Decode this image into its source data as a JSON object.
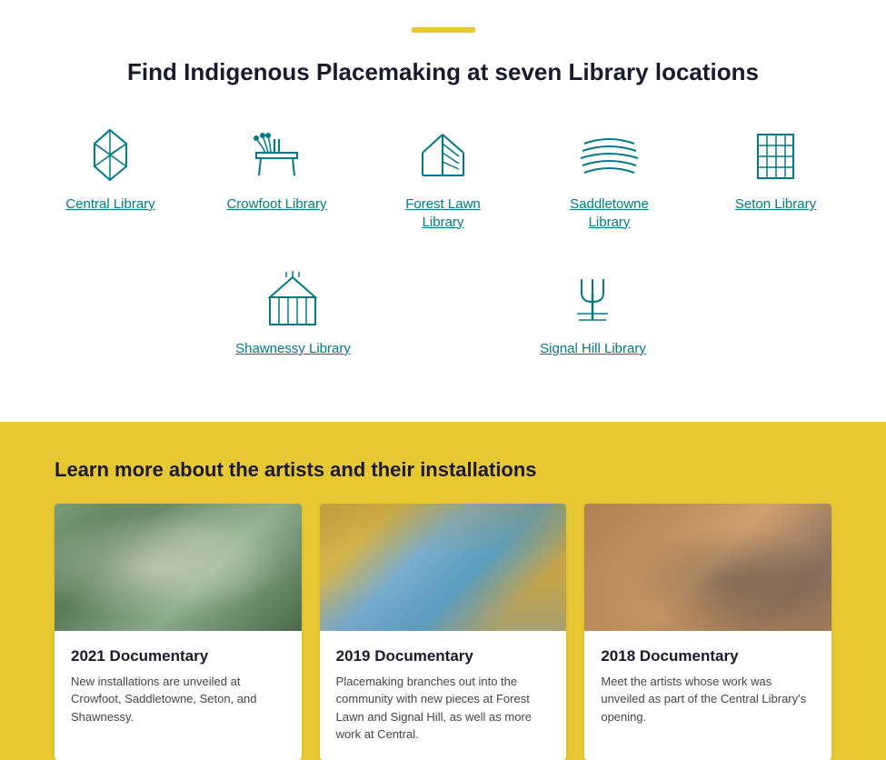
{
  "header": {
    "accent_bar": true,
    "title": "Find Indigenous Placemaking at seven Library locations"
  },
  "libraries": {
    "row1": [
      {
        "id": "central",
        "label": "Central Library",
        "icon": "central"
      },
      {
        "id": "crowfoot",
        "label": "Crowfoot Library",
        "icon": "crowfoot"
      },
      {
        "id": "forestlawn",
        "label": "Forest Lawn Library",
        "icon": "forestlawn"
      },
      {
        "id": "saddletowne",
        "label": "Saddletowne Library",
        "icon": "saddletowne"
      },
      {
        "id": "seton",
        "label": "Seton Library",
        "icon": "seton"
      }
    ],
    "row2": [
      {
        "id": "shawnessy",
        "label": "Shawnessy Library",
        "icon": "shawnessy"
      },
      {
        "id": "signalhill",
        "label": "Signal Hill Library",
        "icon": "signalhill"
      }
    ]
  },
  "artists_section": {
    "title": "Learn more about the artists and their installations",
    "cards": [
      {
        "id": "doc2021",
        "year": "2021 Documentary",
        "desc": "New installations are unveiled at Crowfoot, Saddletowne, Seton, and Shawnessy.",
        "img_class": "img-2021"
      },
      {
        "id": "doc2019",
        "year": "2019 Documentary",
        "desc": "Placemaking branches out into the community with new pieces at Forest Lawn and Signal Hill, as well as more work at Central.",
        "img_class": "img-2019"
      },
      {
        "id": "doc2018",
        "year": "2018 Documentary",
        "desc": "Meet the artists whose work was unveiled as part of the Central Library's opening.",
        "img_class": "img-2018"
      }
    ]
  }
}
